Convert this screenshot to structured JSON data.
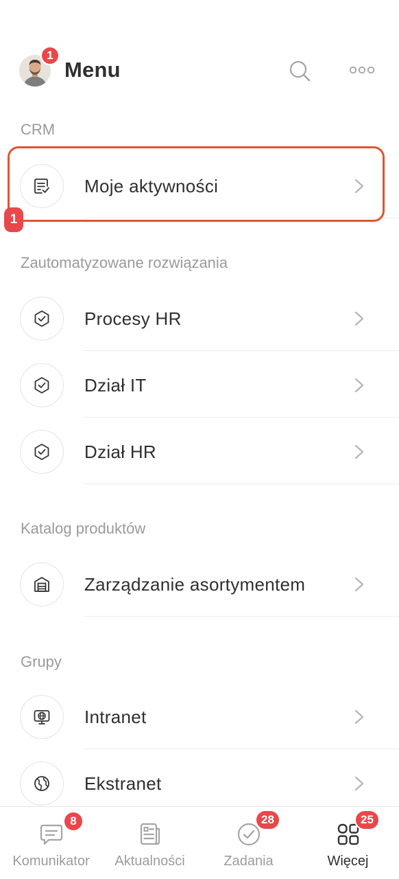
{
  "header": {
    "title": "Menu",
    "avatar_badge": "1",
    "icons": {
      "search": "search-icon",
      "more": "more-horizontal-icon"
    }
  },
  "sections": [
    {
      "label": "CRM",
      "items": [
        {
          "label": "Moje aktywności",
          "icon": "checklist-document-icon"
        }
      ]
    },
    {
      "label": "Zautomatyzowane rozwiązania",
      "items": [
        {
          "label": "Procesy HR",
          "icon": "hexagon-check-icon"
        },
        {
          "label": "Dział IT",
          "icon": "hexagon-check-icon"
        },
        {
          "label": "Dział HR",
          "icon": "hexagon-check-icon"
        }
      ]
    },
    {
      "label": "Katalog produktów",
      "items": [
        {
          "label": "Zarządzanie asortymentem",
          "icon": "warehouse-icon"
        }
      ]
    },
    {
      "label": "Grupy",
      "items": [
        {
          "label": "Intranet",
          "icon": "globe-monitor-icon"
        },
        {
          "label": "Ekstranet",
          "icon": "globe-icon"
        }
      ]
    }
  ],
  "highlight": {
    "step_number": "1",
    "color": "#e05431"
  },
  "tabbar": {
    "tabs": [
      {
        "label": "Komunikator",
        "badge": "8",
        "icon": "chat-icon"
      },
      {
        "label": "Aktualności",
        "badge": "",
        "icon": "news-icon"
      },
      {
        "label": "Zadania",
        "badge": "28",
        "icon": "check-circle-icon"
      },
      {
        "label": "Więcej",
        "badge": "25",
        "icon": "grid-icon"
      }
    ],
    "active_index": 3
  },
  "colors": {
    "badge": "#e8484b",
    "text": "#2f2f2f",
    "muted": "#9a9a9a"
  }
}
